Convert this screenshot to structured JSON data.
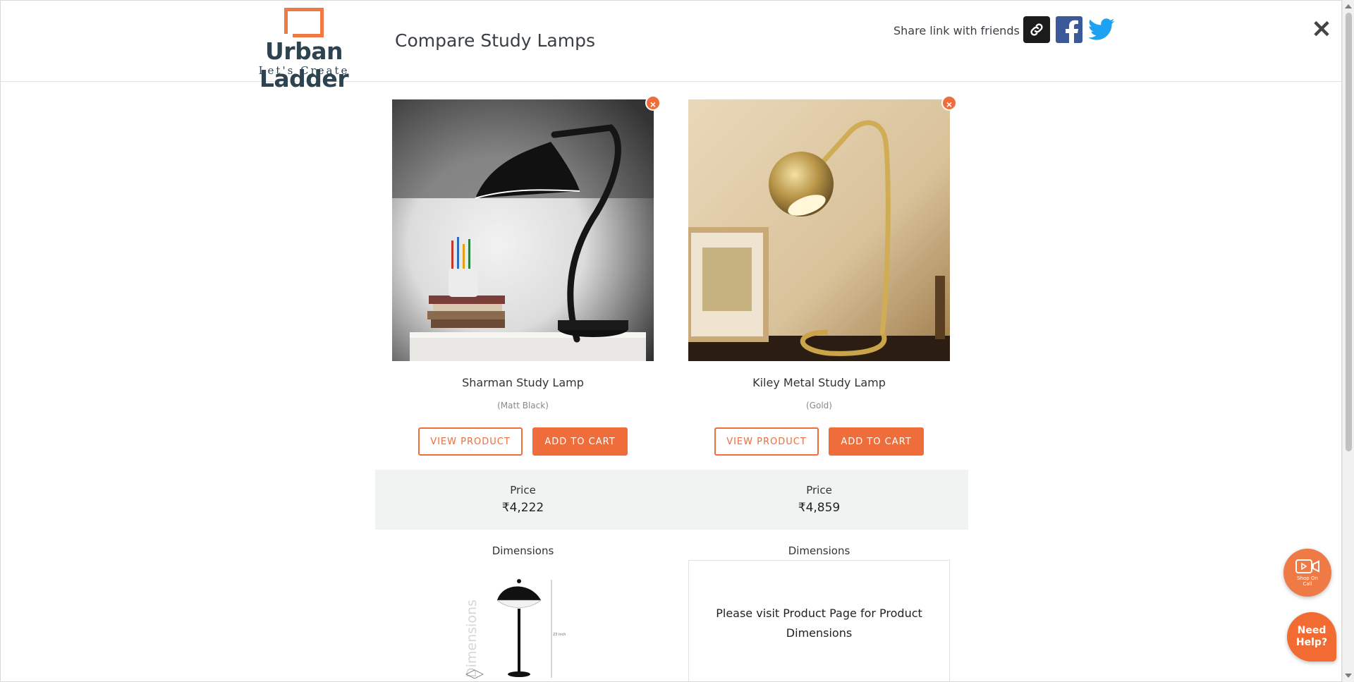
{
  "brand": {
    "name": "Urban Ladder",
    "tagline": "Let's Create",
    "accent_color": "#ef6d3a",
    "text_color": "#2d4350"
  },
  "header": {
    "title": "Compare Study Lamps",
    "share_label": "Share link with friends",
    "share_icons": [
      "link-icon",
      "facebook-icon",
      "twitter-icon"
    ],
    "close_icon": "close-icon"
  },
  "products": [
    {
      "name": "Sharman Study Lamp",
      "variant": "(Matt Black)",
      "view_label": "VIEW PRODUCT",
      "cart_label": "ADD TO CART",
      "price_label": "Price",
      "price": "₹4,222",
      "dimensions_label": "Dimensions",
      "dimensions_watermark": "Dimensions",
      "dimensions_height_label": "23 inch"
    },
    {
      "name": "Kiley Metal Study Lamp",
      "variant": "(Gold)",
      "view_label": "VIEW PRODUCT",
      "cart_label": "ADD TO CART",
      "price_label": "Price",
      "price": "₹4,859",
      "dimensions_label": "Dimensions",
      "dimensions_note": "Please visit Product Page for Product Dimensions"
    }
  ],
  "floating": {
    "shop_on_call": "Shop On Call",
    "need_help": "Need Help?"
  }
}
